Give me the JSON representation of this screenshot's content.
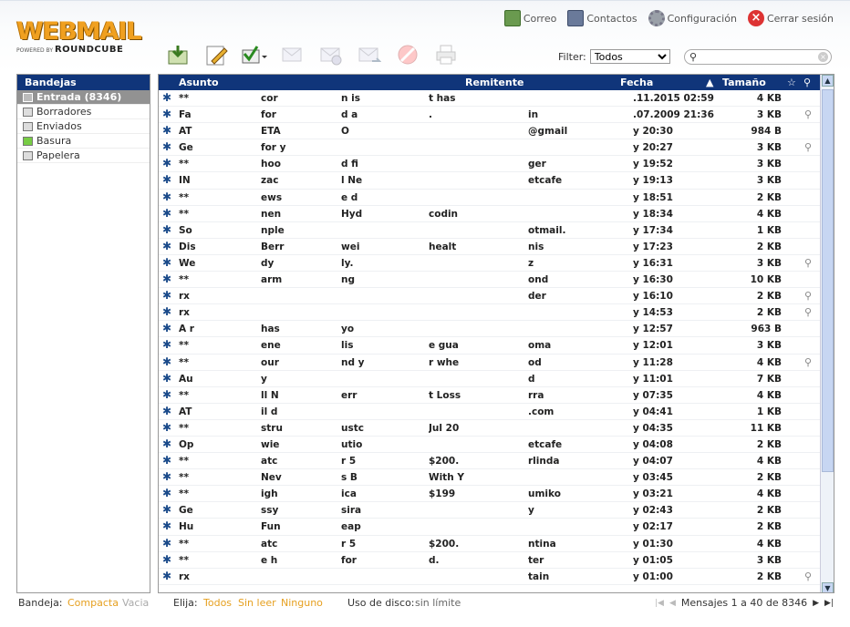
{
  "logo": {
    "main": "WEBMAIL",
    "powered": "POWERED BY",
    "brand": "ROUNDCUBE"
  },
  "topnav": {
    "mail": "Correo",
    "contacts": "Contactos",
    "settings": "Configuración",
    "logout": "Cerrar sesión"
  },
  "filter": {
    "label": "Filter:",
    "selected": "Todos"
  },
  "search": {
    "value": ""
  },
  "sidebar": {
    "title": "Bandejas",
    "folders": [
      {
        "name": "Entrada (8346)",
        "icon": "inbox-icon"
      },
      {
        "name": "Borradores",
        "icon": "drafts-icon"
      },
      {
        "name": "Enviados",
        "icon": "sent-icon"
      },
      {
        "name": "Basura",
        "icon": "junk-icon"
      },
      {
        "name": "Papelera",
        "icon": "trash-icon"
      }
    ]
  },
  "columns": {
    "subject": "Asunto",
    "from": "Remitente",
    "date": "Fecha",
    "size": "Tamaño"
  },
  "messages": [
    {
      "p": [
        "**",
        "cor",
        "n is",
        "t has",
        ""
      ],
      "date": ".11.2015 02:59",
      "size": "4 KB",
      "att": false
    },
    {
      "p": [
        "Fa",
        "for",
        "d a",
        ".",
        "in"
      ],
      "date": ".07.2009 21:36",
      "size": "3 KB",
      "att": true
    },
    {
      "p": [
        "AT",
        "ETA",
        "O",
        "",
        "@gmail"
      ],
      "date": "y 20:30",
      "size": "984 B",
      "att": false
    },
    {
      "p": [
        "Ge",
        "for y",
        "",
        "",
        ""
      ],
      "date": "y 20:27",
      "size": "3 KB",
      "att": true
    },
    {
      "p": [
        "**",
        "hoo",
        "d fi",
        "",
        "ger"
      ],
      "date": "y 19:52",
      "size": "3 KB",
      "att": false
    },
    {
      "p": [
        "IN",
        "zac",
        "l Ne",
        "",
        "etcafe"
      ],
      "date": "y 19:13",
      "size": "3 KB",
      "att": false
    },
    {
      "p": [
        "**",
        "ews",
        "e d",
        "",
        ""
      ],
      "date": "y 18:51",
      "size": "2 KB",
      "att": false
    },
    {
      "p": [
        "**",
        "nen",
        "Hyd",
        "codin",
        ""
      ],
      "date": "y 18:34",
      "size": "4 KB",
      "att": false
    },
    {
      "p": [
        "So",
        "nple",
        "",
        "",
        "otmail."
      ],
      "date": "y 17:34",
      "size": "1 KB",
      "att": false
    },
    {
      "p": [
        "Dis",
        "Berr",
        "wei",
        "healt",
        "nis"
      ],
      "date": "y 17:23",
      "size": "2 KB",
      "att": false
    },
    {
      "p": [
        "We",
        "dy",
        "ly.",
        "",
        "z"
      ],
      "date": "y 16:31",
      "size": "3 KB",
      "att": true
    },
    {
      "p": [
        "**",
        "arm",
        "ng",
        "",
        "ond"
      ],
      "date": "y 16:30",
      "size": "10 KB",
      "att": false
    },
    {
      "p": [
        "rx",
        "",
        "",
        "",
        "der"
      ],
      "date": "y 16:10",
      "size": "2 KB",
      "att": true
    },
    {
      "p": [
        "rx",
        "",
        "",
        "",
        ""
      ],
      "date": "y 14:53",
      "size": "2 KB",
      "att": true
    },
    {
      "p": [
        "A r",
        "has",
        "yo",
        "",
        ""
      ],
      "date": "y 12:57",
      "size": "963 B",
      "att": false
    },
    {
      "p": [
        "**",
        "ene",
        "lis",
        "e gua",
        "oma"
      ],
      "date": "y 12:01",
      "size": "3 KB",
      "att": false
    },
    {
      "p": [
        "**",
        "our",
        "nd y",
        "r whe",
        "od"
      ],
      "date": "y 11:28",
      "size": "4 KB",
      "att": true
    },
    {
      "p": [
        "Au",
        "y",
        "",
        "",
        "d"
      ],
      "date": "y 11:01",
      "size": "7 KB",
      "att": false
    },
    {
      "p": [
        "**",
        "ll N",
        "err",
        "t Loss",
        "rra"
      ],
      "date": "y 07:35",
      "size": "4 KB",
      "att": false
    },
    {
      "p": [
        "AT",
        "il d",
        "",
        "",
        ".com"
      ],
      "date": "y 04:41",
      "size": "1 KB",
      "att": false
    },
    {
      "p": [
        "**",
        "stru",
        "ustc",
        "Jul 20",
        ""
      ],
      "date": "y 04:35",
      "size": "11 KB",
      "att": false
    },
    {
      "p": [
        "Op",
        "wie",
        "utio",
        "",
        "etcafe"
      ],
      "date": "y 04:08",
      "size": "2 KB",
      "att": false
    },
    {
      "p": [
        "**",
        "atc",
        "r 5",
        "$200.",
        "rlinda"
      ],
      "date": "y 04:07",
      "size": "4 KB",
      "att": false
    },
    {
      "p": [
        "**",
        "Nev",
        "s B",
        "With Y",
        ""
      ],
      "date": "y 03:45",
      "size": "2 KB",
      "att": false
    },
    {
      "p": [
        "**",
        "igh",
        "ica",
        "$199",
        "umiko"
      ],
      "date": "y 03:21",
      "size": "4 KB",
      "att": false
    },
    {
      "p": [
        "Ge",
        "ssy",
        "sira",
        "",
        "y"
      ],
      "date": "y 02:43",
      "size": "2 KB",
      "att": false
    },
    {
      "p": [
        "Hu",
        "Fun",
        "eap",
        "",
        ""
      ],
      "date": "y 02:17",
      "size": "2 KB",
      "att": false
    },
    {
      "p": [
        "**",
        "atc",
        "r 5",
        "$200.",
        "ntina"
      ],
      "date": "y 01:30",
      "size": "4 KB",
      "att": false
    },
    {
      "p": [
        "**",
        "e h",
        "for",
        "d.",
        "ter"
      ],
      "date": "y 01:05",
      "size": "3 KB",
      "att": false
    },
    {
      "p": [
        "rx",
        "",
        "",
        "",
        "tain"
      ],
      "date": "y 01:00",
      "size": "2 KB",
      "att": true
    }
  ],
  "footer": {
    "folder_label": "Bandeja:",
    "compact": "Compacta",
    "empty": "Vacia",
    "select_label": "Elija:",
    "all": "Todos",
    "unread": "Sin leer",
    "none": "Ninguno",
    "quota_label": "Uso de disco:",
    "quota_value": "sin límite",
    "count": "Mensajes 1 a 40 de 8346"
  }
}
